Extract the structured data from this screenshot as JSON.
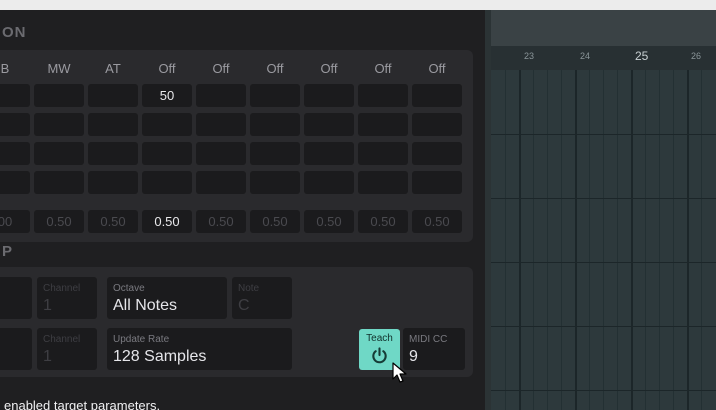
{
  "mapping_section": {
    "title": "ON",
    "columns": [
      "B",
      "MW",
      "AT",
      "Off",
      "Off",
      "Off",
      "Off",
      "Off",
      "Off"
    ],
    "row1_values": [
      "",
      "",
      "",
      "50",
      "",
      "",
      "",
      "",
      ""
    ],
    "depth_values": [
      "00",
      "0.50",
      "0.50",
      "0.50",
      "0.50",
      "0.50",
      "0.50",
      "0.50",
      "0.50"
    ]
  },
  "midi_section": {
    "title": "P",
    "row1": {
      "channel_label": "Channel",
      "channel_value": "1",
      "octave_label": "Octave",
      "octave_value": "All Notes",
      "note_label": "Note",
      "note_value": "C"
    },
    "row2": {
      "channel_label": "Channel",
      "channel_value": "1",
      "update_rate_label": "Update Rate",
      "update_rate_value": "128 Samples",
      "teach_label": "Teach",
      "midi_cc_label": "MIDI CC",
      "midi_cc_value": "9"
    }
  },
  "status_text": "enabled target parameters.",
  "timeline": {
    "bars": [
      "23",
      "24",
      "25",
      "26"
    ],
    "current_bar": "25"
  },
  "colors": {
    "panel_bg": "#1f1f21",
    "teach_accent": "#6fd8c6",
    "sequencer_bg": "#2d393c"
  }
}
